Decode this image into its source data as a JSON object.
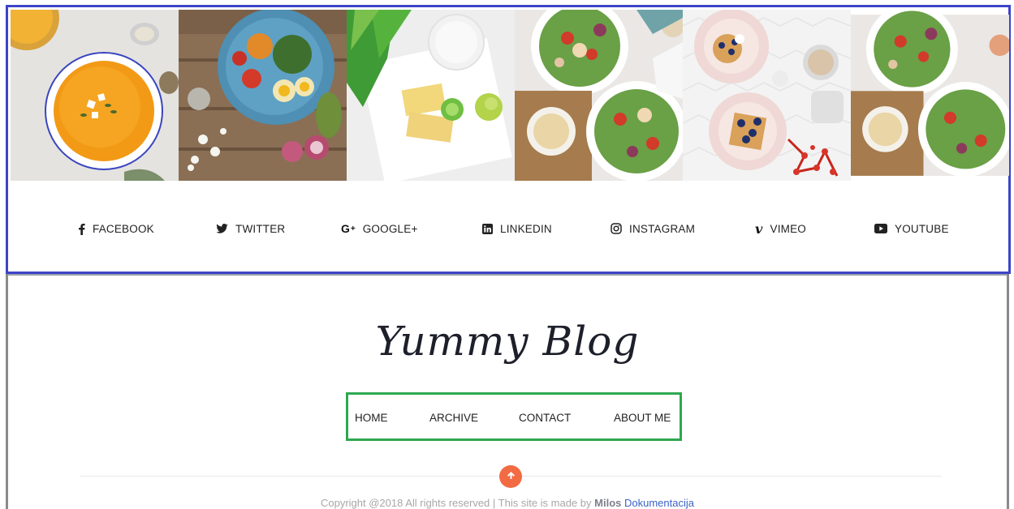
{
  "gallery": {
    "images": [
      {
        "name": "pumpkin-soup-photo"
      },
      {
        "name": "salad-bowl-photo"
      },
      {
        "name": "sandwich-plate-photo"
      },
      {
        "name": "salad-plates-photo"
      },
      {
        "name": "waffles-photo"
      },
      {
        "name": "salad-plates-photo-2"
      }
    ]
  },
  "social": {
    "items": [
      {
        "label": "FACEBOOK",
        "icon": "facebook-icon"
      },
      {
        "label": "TWITTER",
        "icon": "twitter-icon"
      },
      {
        "label": "GOOGLE+",
        "icon": "google-plus-icon"
      },
      {
        "label": "LINKEDIN",
        "icon": "linkedin-icon"
      },
      {
        "label": "INSTAGRAM",
        "icon": "instagram-icon"
      },
      {
        "label": "VIMEO",
        "icon": "vimeo-icon"
      },
      {
        "label": "YOUTUBE",
        "icon": "youtube-icon"
      }
    ]
  },
  "blog": {
    "title": "Yummy Blog",
    "nav": [
      {
        "label": "HOME"
      },
      {
        "label": "ARCHIVE"
      },
      {
        "label": "CONTACT"
      },
      {
        "label": "ABOUT ME"
      }
    ]
  },
  "footer": {
    "copyright_text": "Copyright @2018 All rights reserved | This site is made by ",
    "author": "Milos",
    "link": "Dokumentacija"
  },
  "colors": {
    "top_highlight": "#3d44c8",
    "nav_highlight": "#2ea84f",
    "scroll_button": "#f26b43",
    "link": "#3c63c7"
  }
}
